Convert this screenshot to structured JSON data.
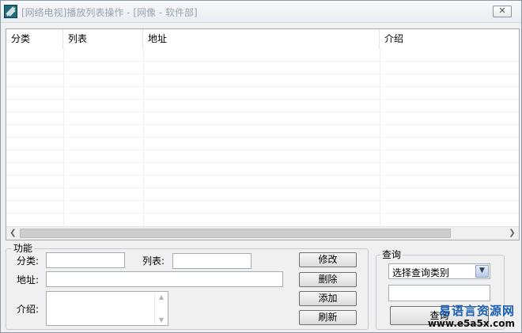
{
  "window": {
    "title": "[网络电视]播放列表操作 - [网像 - 软件部]",
    "close_glyph": "✕"
  },
  "list": {
    "columns": [
      "分类",
      "列表",
      "地址",
      "介绍"
    ],
    "rows": []
  },
  "function_group": {
    "title": "功能",
    "category_label": "分类:",
    "list_label": "列表:",
    "address_label": "地址:",
    "intro_label": "介绍:",
    "category_value": "",
    "list_value": "",
    "address_value": "",
    "intro_value": "",
    "buttons": {
      "modify": "修改",
      "delete": "删除",
      "add": "添加",
      "refresh": "刷新"
    }
  },
  "query_group": {
    "title": "查询",
    "type_selected": "选择查询类别",
    "query_value": "",
    "button_label": "查询"
  },
  "watermark": {
    "title": "易语言资源网",
    "url": "www.e5a5x.com"
  },
  "icons": {
    "app": "app-icon",
    "close": "close-icon",
    "scroll_left": "chevron-left-icon",
    "scroll_right": "chevron-right-icon",
    "dropdown": "chevron-down-icon"
  },
  "colors": {
    "window_bg": "#f0f0f0",
    "app_icon": "#1d6d7d",
    "watermark": "#1a5fb4"
  }
}
